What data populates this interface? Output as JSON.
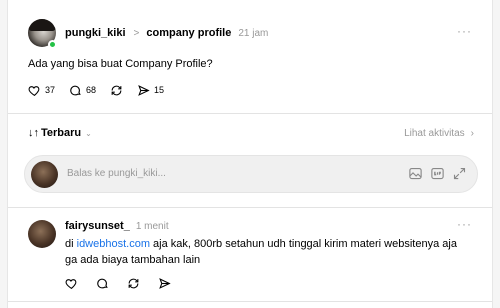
{
  "post": {
    "username": "pungki_kiki",
    "separator": ">",
    "community": "company profile",
    "time": "21 jam",
    "more": "···",
    "text": "Ada yang bisa buat Company Profile?",
    "likes": "37",
    "comments": "68",
    "reposts": "",
    "shares": "15"
  },
  "sort": {
    "label": "Terbaru",
    "activity_label": "Lihat aktivitas"
  },
  "reply": {
    "placeholder": "Balas ke pungki_kiki..."
  },
  "comment": {
    "username": "fairysunset_",
    "time": "1 menit",
    "more": "···",
    "text_prefix": "di ",
    "link": "idwebhost.com",
    "text_suffix": " aja kak, 800rb setahun udh tinggal kirim materi websitenya aja ga ada biaya tambahan lain"
  },
  "colors": {
    "link": "#1a73e8",
    "online": "#24c146",
    "muted": "#999999"
  }
}
